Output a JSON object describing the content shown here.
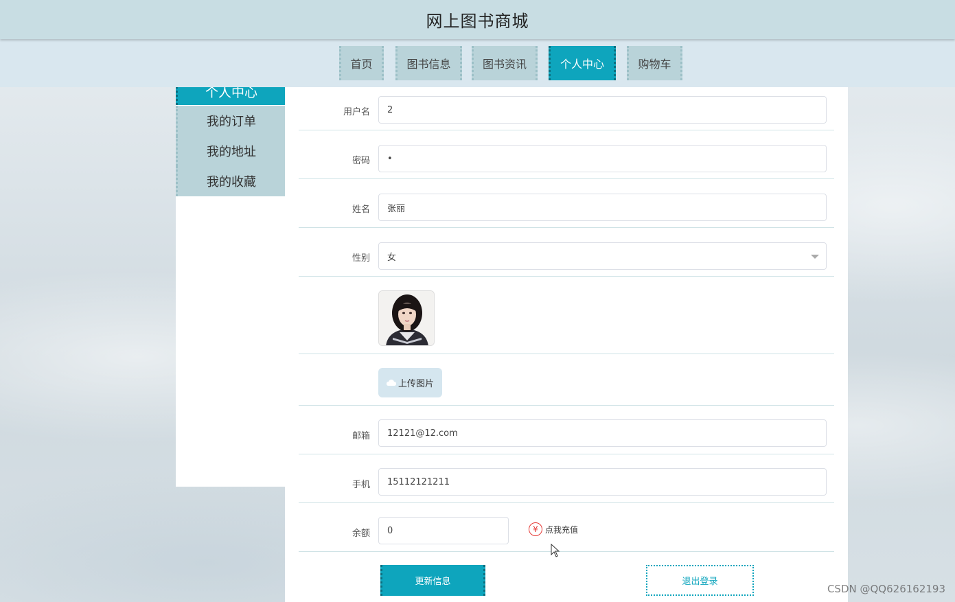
{
  "header": {
    "title": "网上图书商城"
  },
  "nav": {
    "items": [
      {
        "label": "首页"
      },
      {
        "label": "图书信息"
      },
      {
        "label": "图书资讯"
      },
      {
        "label": "个人中心"
      },
      {
        "label": "购物车"
      }
    ],
    "active_index": 3
  },
  "sidebar": {
    "heading": "个人中心",
    "items": [
      {
        "label": "我的订单"
      },
      {
        "label": "我的地址"
      },
      {
        "label": "我的收藏"
      }
    ]
  },
  "form": {
    "username": {
      "label": "用户名",
      "value": "2"
    },
    "password": {
      "label": "密码",
      "value": "•"
    },
    "name": {
      "label": "姓名",
      "value": "张丽"
    },
    "gender": {
      "label": "性别",
      "value": "女"
    },
    "upload": {
      "label": "上传图片"
    },
    "email": {
      "label": "邮箱",
      "value": "12121@12.com"
    },
    "phone": {
      "label": "手机",
      "value": "15112121211"
    },
    "balance": {
      "label": "余额",
      "value": "0"
    },
    "recharge": {
      "icon_text": "¥",
      "label": "点我充值"
    }
  },
  "buttons": {
    "update": "更新信息",
    "logout": "退出登录"
  },
  "watermark": "CSDN @QQ626162193",
  "colors": {
    "accent": "#0ea5bd",
    "nav": "#b9d3d9",
    "header": "#c8dde3"
  }
}
